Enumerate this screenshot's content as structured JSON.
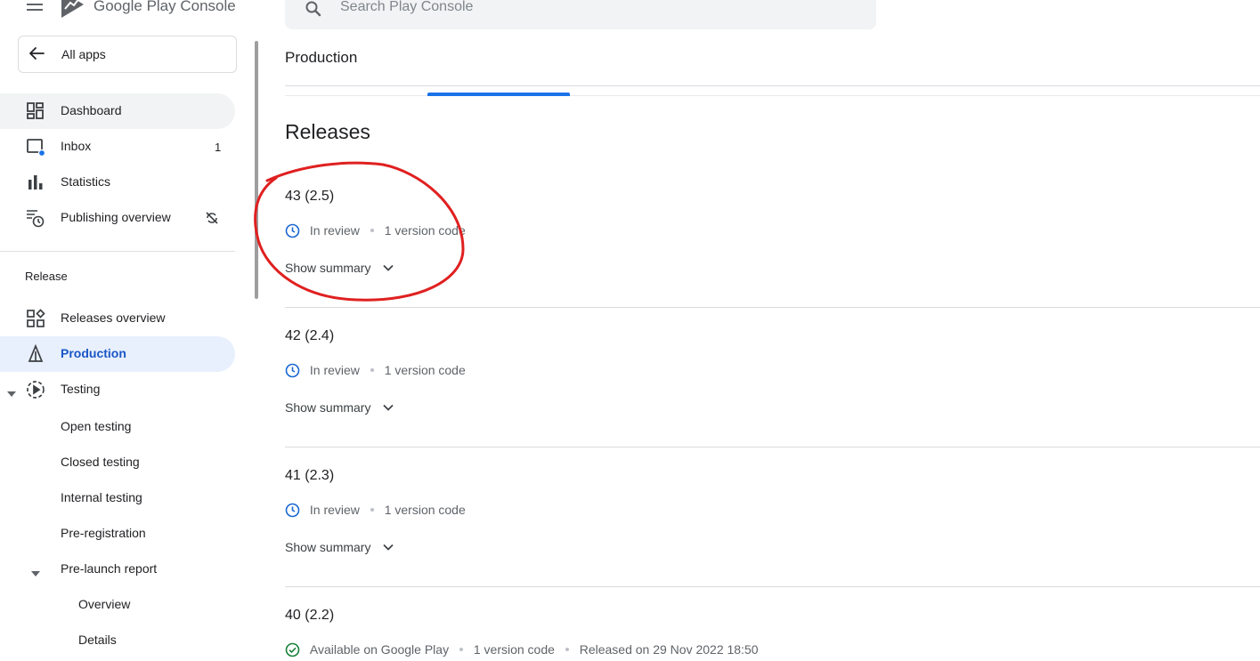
{
  "header": {
    "brand_google": "Google",
    "brand_play": "Play",
    "brand_console": "Console",
    "search_placeholder": "Search Play Console",
    "icons": {
      "menu": "hamburger-menu-icon",
      "search": "search-icon",
      "logo": "play-console-logo"
    }
  },
  "sidebar": {
    "back_label": "All apps",
    "items": [
      {
        "label": "Dashboard",
        "icon": "dashboard-icon"
      },
      {
        "label": "Inbox",
        "icon": "inbox-icon",
        "count": "1"
      },
      {
        "label": "Statistics",
        "icon": "bar-chart-icon"
      },
      {
        "label": "Publishing overview",
        "icon": "publishing-overview-icon",
        "trailing_icon": "sync-disabled-icon"
      }
    ],
    "section_title": "Release",
    "release_items": [
      {
        "label": "Releases overview",
        "icon": "releases-overview-icon"
      },
      {
        "label": "Production",
        "icon": "production-icon"
      },
      {
        "label": "Testing",
        "icon": "testing-icon"
      }
    ],
    "testing_sub": [
      "Open testing",
      "Closed testing",
      "Internal testing",
      "Pre-registration"
    ],
    "prelaunch_label": "Pre-launch report",
    "prelaunch_sub": [
      "Overview",
      "Details"
    ]
  },
  "main": {
    "page_title": "Production",
    "releases_heading": "Releases",
    "releases": [
      {
        "title": "43 (2.5)",
        "status": "In review",
        "version_codes": "1 version code",
        "summary": "Show summary",
        "icon": "clock-icon"
      },
      {
        "title": "42 (2.4)",
        "status": "In review",
        "version_codes": "1 version code",
        "summary": "Show summary",
        "icon": "clock-icon"
      },
      {
        "title": "41 (2.3)",
        "status": "In review",
        "version_codes": "1 version code",
        "summary": "Show summary",
        "icon": "clock-icon"
      },
      {
        "title": "40 (2.2)",
        "status": "Available on Google Play",
        "version_codes": "1 version code",
        "released": "Released on 29 Nov 2022 18:50",
        "icon": "check-circle-icon"
      }
    ]
  },
  "colors": {
    "accent_blue": "#1a73e8",
    "selected_nav_bg": "#e8f0fe",
    "annotation_red": "#e02020",
    "status_green": "#188038"
  }
}
